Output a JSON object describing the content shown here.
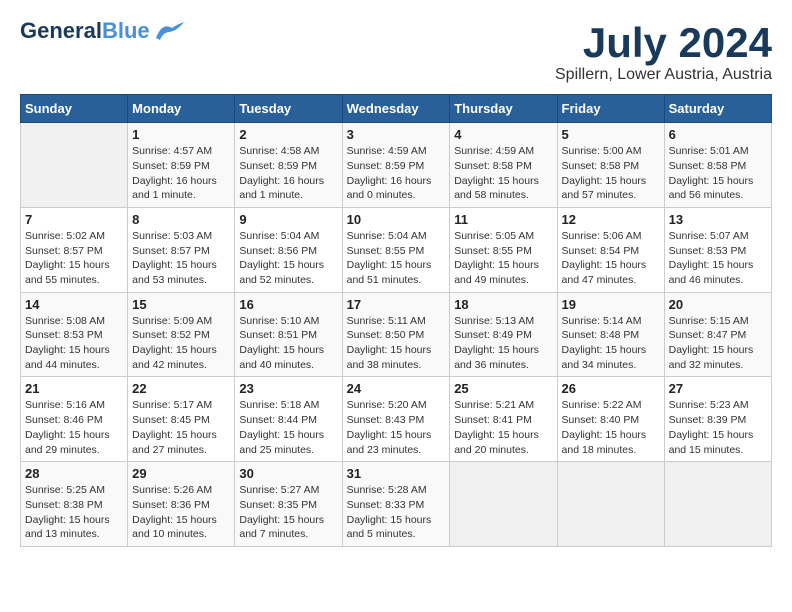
{
  "header": {
    "logo_general": "General",
    "logo_blue": "Blue",
    "month": "July 2024",
    "location": "Spillern, Lower Austria, Austria"
  },
  "weekdays": [
    "Sunday",
    "Monday",
    "Tuesday",
    "Wednesday",
    "Thursday",
    "Friday",
    "Saturday"
  ],
  "weeks": [
    [
      {
        "day": "",
        "sunrise": "",
        "sunset": "",
        "daylight": ""
      },
      {
        "day": "1",
        "sunrise": "Sunrise: 4:57 AM",
        "sunset": "Sunset: 8:59 PM",
        "daylight": "Daylight: 16 hours and 1 minute."
      },
      {
        "day": "2",
        "sunrise": "Sunrise: 4:58 AM",
        "sunset": "Sunset: 8:59 PM",
        "daylight": "Daylight: 16 hours and 1 minute."
      },
      {
        "day": "3",
        "sunrise": "Sunrise: 4:59 AM",
        "sunset": "Sunset: 8:59 PM",
        "daylight": "Daylight: 16 hours and 0 minutes."
      },
      {
        "day": "4",
        "sunrise": "Sunrise: 4:59 AM",
        "sunset": "Sunset: 8:58 PM",
        "daylight": "Daylight: 15 hours and 58 minutes."
      },
      {
        "day": "5",
        "sunrise": "Sunrise: 5:00 AM",
        "sunset": "Sunset: 8:58 PM",
        "daylight": "Daylight: 15 hours and 57 minutes."
      },
      {
        "day": "6",
        "sunrise": "Sunrise: 5:01 AM",
        "sunset": "Sunset: 8:58 PM",
        "daylight": "Daylight: 15 hours and 56 minutes."
      }
    ],
    [
      {
        "day": "7",
        "sunrise": "Sunrise: 5:02 AM",
        "sunset": "Sunset: 8:57 PM",
        "daylight": "Daylight: 15 hours and 55 minutes."
      },
      {
        "day": "8",
        "sunrise": "Sunrise: 5:03 AM",
        "sunset": "Sunset: 8:57 PM",
        "daylight": "Daylight: 15 hours and 53 minutes."
      },
      {
        "day": "9",
        "sunrise": "Sunrise: 5:04 AM",
        "sunset": "Sunset: 8:56 PM",
        "daylight": "Daylight: 15 hours and 52 minutes."
      },
      {
        "day": "10",
        "sunrise": "Sunrise: 5:04 AM",
        "sunset": "Sunset: 8:55 PM",
        "daylight": "Daylight: 15 hours and 51 minutes."
      },
      {
        "day": "11",
        "sunrise": "Sunrise: 5:05 AM",
        "sunset": "Sunset: 8:55 PM",
        "daylight": "Daylight: 15 hours and 49 minutes."
      },
      {
        "day": "12",
        "sunrise": "Sunrise: 5:06 AM",
        "sunset": "Sunset: 8:54 PM",
        "daylight": "Daylight: 15 hours and 47 minutes."
      },
      {
        "day": "13",
        "sunrise": "Sunrise: 5:07 AM",
        "sunset": "Sunset: 8:53 PM",
        "daylight": "Daylight: 15 hours and 46 minutes."
      }
    ],
    [
      {
        "day": "14",
        "sunrise": "Sunrise: 5:08 AM",
        "sunset": "Sunset: 8:53 PM",
        "daylight": "Daylight: 15 hours and 44 minutes."
      },
      {
        "day": "15",
        "sunrise": "Sunrise: 5:09 AM",
        "sunset": "Sunset: 8:52 PM",
        "daylight": "Daylight: 15 hours and 42 minutes."
      },
      {
        "day": "16",
        "sunrise": "Sunrise: 5:10 AM",
        "sunset": "Sunset: 8:51 PM",
        "daylight": "Daylight: 15 hours and 40 minutes."
      },
      {
        "day": "17",
        "sunrise": "Sunrise: 5:11 AM",
        "sunset": "Sunset: 8:50 PM",
        "daylight": "Daylight: 15 hours and 38 minutes."
      },
      {
        "day": "18",
        "sunrise": "Sunrise: 5:13 AM",
        "sunset": "Sunset: 8:49 PM",
        "daylight": "Daylight: 15 hours and 36 minutes."
      },
      {
        "day": "19",
        "sunrise": "Sunrise: 5:14 AM",
        "sunset": "Sunset: 8:48 PM",
        "daylight": "Daylight: 15 hours and 34 minutes."
      },
      {
        "day": "20",
        "sunrise": "Sunrise: 5:15 AM",
        "sunset": "Sunset: 8:47 PM",
        "daylight": "Daylight: 15 hours and 32 minutes."
      }
    ],
    [
      {
        "day": "21",
        "sunrise": "Sunrise: 5:16 AM",
        "sunset": "Sunset: 8:46 PM",
        "daylight": "Daylight: 15 hours and 29 minutes."
      },
      {
        "day": "22",
        "sunrise": "Sunrise: 5:17 AM",
        "sunset": "Sunset: 8:45 PM",
        "daylight": "Daylight: 15 hours and 27 minutes."
      },
      {
        "day": "23",
        "sunrise": "Sunrise: 5:18 AM",
        "sunset": "Sunset: 8:44 PM",
        "daylight": "Daylight: 15 hours and 25 minutes."
      },
      {
        "day": "24",
        "sunrise": "Sunrise: 5:20 AM",
        "sunset": "Sunset: 8:43 PM",
        "daylight": "Daylight: 15 hours and 23 minutes."
      },
      {
        "day": "25",
        "sunrise": "Sunrise: 5:21 AM",
        "sunset": "Sunset: 8:41 PM",
        "daylight": "Daylight: 15 hours and 20 minutes."
      },
      {
        "day": "26",
        "sunrise": "Sunrise: 5:22 AM",
        "sunset": "Sunset: 8:40 PM",
        "daylight": "Daylight: 15 hours and 18 minutes."
      },
      {
        "day": "27",
        "sunrise": "Sunrise: 5:23 AM",
        "sunset": "Sunset: 8:39 PM",
        "daylight": "Daylight: 15 hours and 15 minutes."
      }
    ],
    [
      {
        "day": "28",
        "sunrise": "Sunrise: 5:25 AM",
        "sunset": "Sunset: 8:38 PM",
        "daylight": "Daylight: 15 hours and 13 minutes."
      },
      {
        "day": "29",
        "sunrise": "Sunrise: 5:26 AM",
        "sunset": "Sunset: 8:36 PM",
        "daylight": "Daylight: 15 hours and 10 minutes."
      },
      {
        "day": "30",
        "sunrise": "Sunrise: 5:27 AM",
        "sunset": "Sunset: 8:35 PM",
        "daylight": "Daylight: 15 hours and 7 minutes."
      },
      {
        "day": "31",
        "sunrise": "Sunrise: 5:28 AM",
        "sunset": "Sunset: 8:33 PM",
        "daylight": "Daylight: 15 hours and 5 minutes."
      },
      {
        "day": "",
        "sunrise": "",
        "sunset": "",
        "daylight": ""
      },
      {
        "day": "",
        "sunrise": "",
        "sunset": "",
        "daylight": ""
      },
      {
        "day": "",
        "sunrise": "",
        "sunset": "",
        "daylight": ""
      }
    ]
  ]
}
